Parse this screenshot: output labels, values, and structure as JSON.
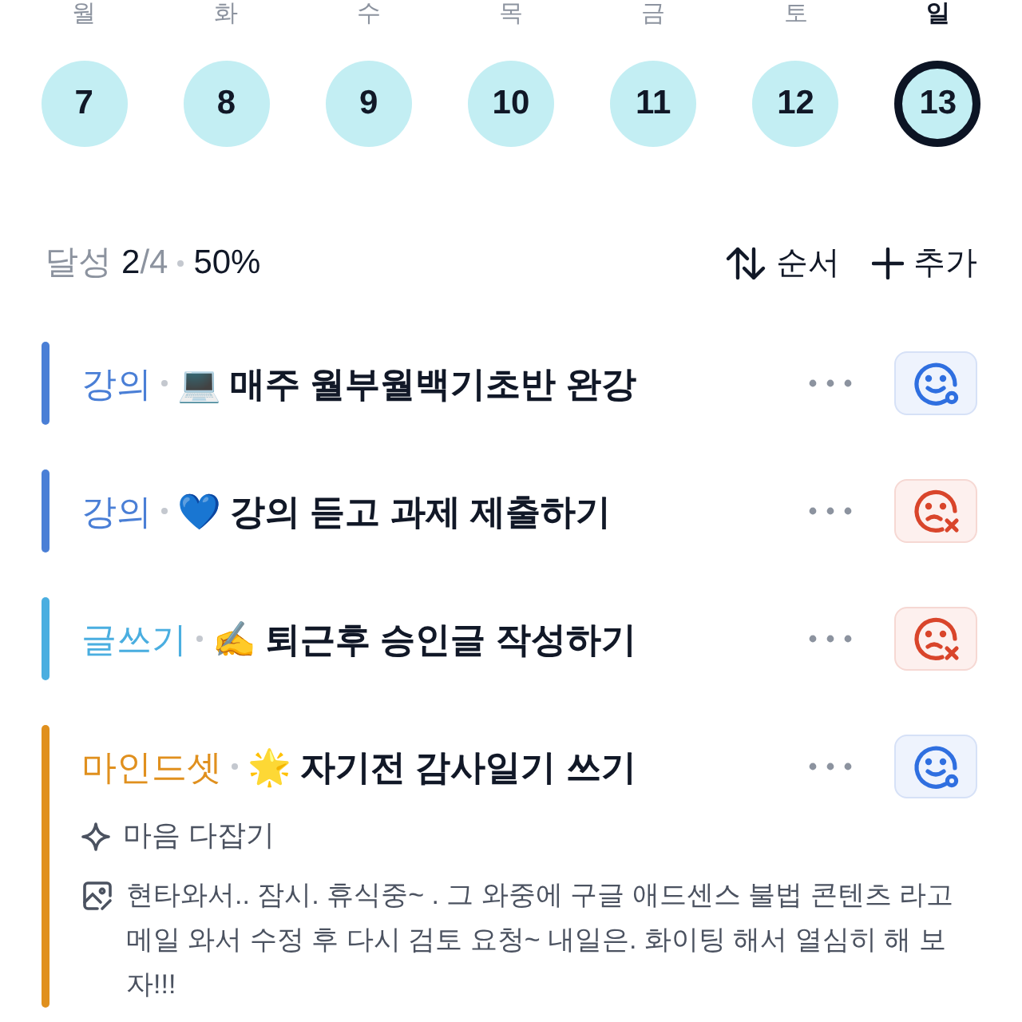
{
  "week": [
    {
      "weekday": "월",
      "day": "7",
      "selected": false
    },
    {
      "weekday": "화",
      "day": "8",
      "selected": false
    },
    {
      "weekday": "수",
      "day": "9",
      "selected": false
    },
    {
      "weekday": "목",
      "day": "10",
      "selected": false
    },
    {
      "weekday": "금",
      "day": "11",
      "selected": false
    },
    {
      "weekday": "토",
      "day": "12",
      "selected": false
    },
    {
      "weekday": "일",
      "day": "13",
      "selected": true
    }
  ],
  "summary": {
    "label": "달성",
    "done": "2",
    "total": "/4",
    "percent": "50%"
  },
  "actions": [
    {
      "kind": "sort",
      "label": "순서"
    },
    {
      "kind": "add",
      "label": "추가"
    }
  ],
  "tasks": [
    {
      "category": "강의",
      "color": "#4a7fd6",
      "emoji": "💻",
      "title": "매주 월부월백기초반 완강",
      "kind": "pending"
    },
    {
      "category": "강의",
      "color": "#4a7fd6",
      "emoji": "💙",
      "title": "강의 듣고 과제 제출하기",
      "kind": "failed"
    },
    {
      "category": "글쓰기",
      "color": "#4aaee0",
      "emoji": "✍️",
      "title": "퇴근후 승인글 작성하기",
      "kind": "failed"
    },
    {
      "category": "마인드셋",
      "color": "#e0901e",
      "emoji": "🌟",
      "title": "자기전 감사일기 쓰기",
      "kind": "pending",
      "subtitle": "마음 다잡기",
      "memo": "현타와서.. 잠시. 휴식중~ . 그 와중에 구글 애드센스 불법 콘텐츠 라고 메일 와서 수정 후 다시 검토 요청~ 내일은. 화이팅 해서 열심히 해 보자!!!"
    }
  ]
}
